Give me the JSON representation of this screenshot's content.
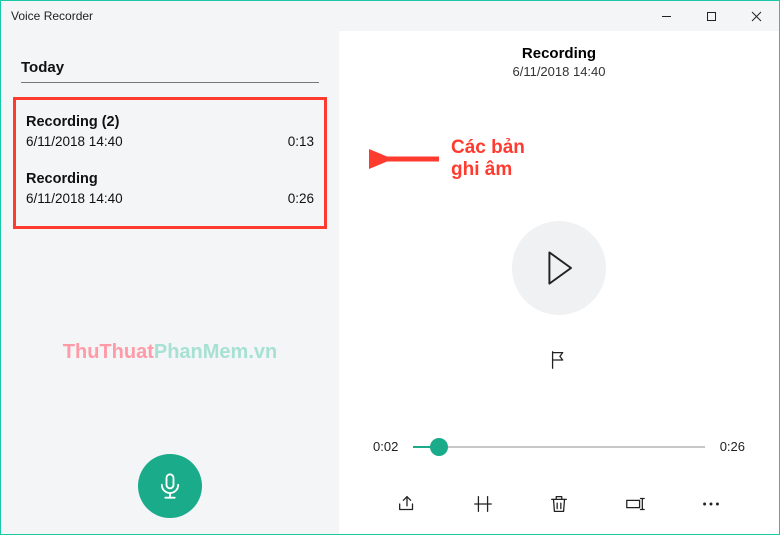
{
  "window": {
    "title": "Voice Recorder"
  },
  "sidebar": {
    "section": "Today",
    "items": [
      {
        "title": "Recording (2)",
        "datetime": "6/11/2018 14:40",
        "duration": "0:13"
      },
      {
        "title": "Recording",
        "datetime": "6/11/2018 14:40",
        "duration": "0:26"
      }
    ]
  },
  "annotation": {
    "line1": "Các bản",
    "line2": "ghi âm"
  },
  "main": {
    "title": "Recording",
    "subtitle": "6/11/2018 14:40",
    "elapsed": "0:02",
    "total": "0:26"
  },
  "watermark": {
    "part1": "ThuThuat",
    "part2": "PhanMem.vn"
  },
  "colors": {
    "accent": "#19ab8a",
    "highlight": "#ff3b30"
  }
}
